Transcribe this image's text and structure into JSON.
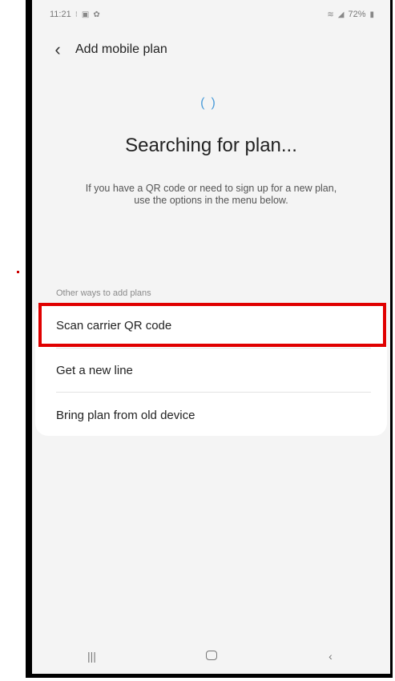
{
  "status_bar": {
    "time": "11:21",
    "battery": "72%",
    "icons_left": [
      "notification-icon",
      "image-icon",
      "settings-icon"
    ],
    "icons_right": [
      "wifi-icon",
      "signal-icon",
      "battery-icon"
    ]
  },
  "header": {
    "back_icon": "chevron-left-icon",
    "title": "Add mobile plan"
  },
  "main": {
    "spinner_icon": "loading-spinner-icon",
    "heading": "Searching for plan...",
    "description": "If you have a QR code or need to sign up for a new plan, use the options in the menu below.",
    "section_label": "Other ways to add plans",
    "options": [
      {
        "label": "Scan carrier QR code",
        "highlighted": true
      },
      {
        "label": "Get a new line"
      },
      {
        "label": "Bring plan from old device"
      }
    ]
  },
  "highlight_color": "#e00000",
  "nav_bar": {
    "icons": [
      "recent-apps-icon",
      "home-icon",
      "back-icon"
    ]
  }
}
